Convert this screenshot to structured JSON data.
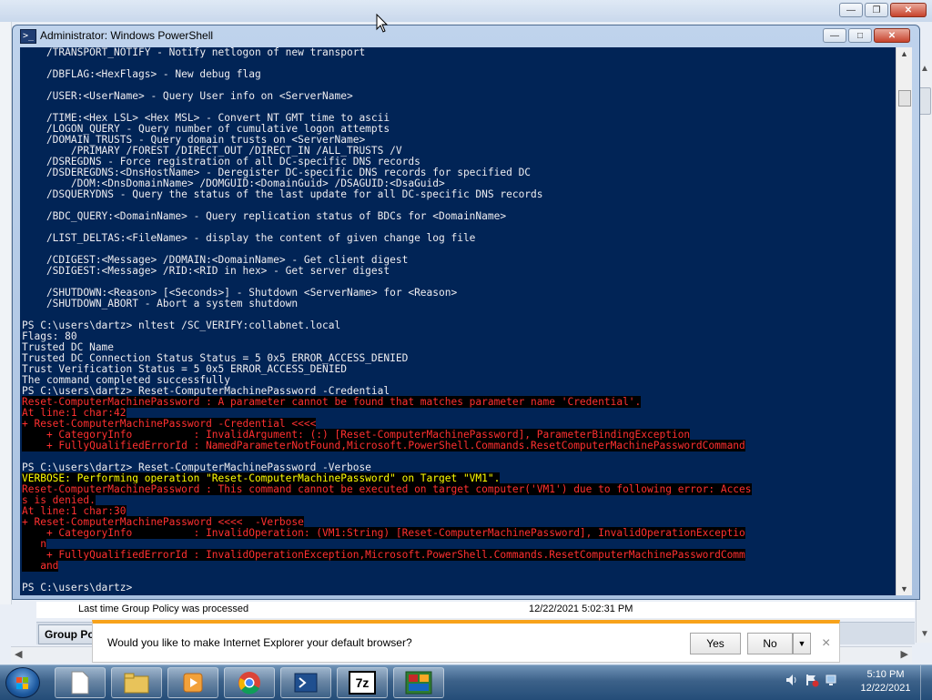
{
  "background": {
    "group_policy": {
      "label": "Last time Group Policy was processed",
      "value": "12/22/2021 5:02:31 PM"
    },
    "tab_label": "Group Poli"
  },
  "powershell": {
    "title": "Administrator: Windows PowerShell",
    "console_lines": [
      {
        "t": "    /TRANSPORT_NOTIFY - Notify netlogon of new transport",
        "s": "out"
      },
      {
        "t": "",
        "s": "out"
      },
      {
        "t": "    /DBFLAG:<HexFlags> - New debug flag",
        "s": "out"
      },
      {
        "t": "",
        "s": "out"
      },
      {
        "t": "    /USER:<UserName> - Query User info on <ServerName>",
        "s": "out"
      },
      {
        "t": "",
        "s": "out"
      },
      {
        "t": "    /TIME:<Hex LSL> <Hex MSL> - Convert NT GMT time to ascii",
        "s": "out"
      },
      {
        "t": "    /LOGON_QUERY - Query number of cumulative logon attempts",
        "s": "out"
      },
      {
        "t": "    /DOMAIN_TRUSTS - Query domain trusts on <ServerName>",
        "s": "out"
      },
      {
        "t": "        /PRIMARY /FOREST /DIRECT_OUT /DIRECT_IN /ALL_TRUSTS /V",
        "s": "out"
      },
      {
        "t": "    /DSREGDNS - Force registration of all DC-specific DNS records",
        "s": "out"
      },
      {
        "t": "    /DSDEREGDNS:<DnsHostName> - Deregister DC-specific DNS records for specified DC",
        "s": "out"
      },
      {
        "t": "        /DOM:<DnsDomainName> /DOMGUID:<DomainGuid> /DSAGUID:<DsaGuid>",
        "s": "out"
      },
      {
        "t": "    /DSQUERYDNS - Query the status of the last update for all DC-specific DNS records",
        "s": "out"
      },
      {
        "t": "",
        "s": "out"
      },
      {
        "t": "    /BDC_QUERY:<DomainName> - Query replication status of BDCs for <DomainName>",
        "s": "out"
      },
      {
        "t": "",
        "s": "out"
      },
      {
        "t": "    /LIST_DELTAS:<FileName> - display the content of given change log file",
        "s": "out"
      },
      {
        "t": "",
        "s": "out"
      },
      {
        "t": "    /CDIGEST:<Message> /DOMAIN:<DomainName> - Get client digest",
        "s": "out"
      },
      {
        "t": "    /SDIGEST:<Message> /RID:<RID in hex> - Get server digest",
        "s": "out"
      },
      {
        "t": "",
        "s": "out"
      },
      {
        "t": "    /SHUTDOWN:<Reason> [<Seconds>] - Shutdown <ServerName> for <Reason>",
        "s": "out"
      },
      {
        "t": "    /SHUTDOWN_ABORT - Abort a system shutdown",
        "s": "out"
      },
      {
        "t": "",
        "s": "out"
      },
      {
        "t": "PS C:\\users\\dartz> nltest /SC_VERIFY:collabnet.local",
        "s": "out"
      },
      {
        "t": "Flags: 80",
        "s": "out"
      },
      {
        "t": "Trusted DC Name",
        "s": "out"
      },
      {
        "t": "Trusted DC Connection Status Status = 5 0x5 ERROR_ACCESS_DENIED",
        "s": "out"
      },
      {
        "t": "Trust Verification Status = 5 0x5 ERROR_ACCESS_DENIED",
        "s": "out"
      },
      {
        "t": "The command completed successfully",
        "s": "out"
      },
      {
        "t": "PS C:\\users\\dartz> Reset-ComputerMachinePassword -Credential",
        "s": "out"
      },
      {
        "t": "Reset-ComputerMachinePassword : A parameter cannot be found that matches parameter name 'Credential'.",
        "s": "err"
      },
      {
        "t": "At line:1 char:42",
        "s": "err"
      },
      {
        "t": "+ Reset-ComputerMachinePassword -Credential <<<<",
        "s": "err"
      },
      {
        "t": "    + CategoryInfo          : InvalidArgument: (:) [Reset-ComputerMachinePassword], ParameterBindingException",
        "s": "err"
      },
      {
        "t": "    + FullyQualifiedErrorId : NamedParameterNotFound,Microsoft.PowerShell.Commands.ResetComputerMachinePasswordCommand",
        "s": "err"
      },
      {
        "t": "",
        "s": "out"
      },
      {
        "t": "PS C:\\users\\dartz> Reset-ComputerMachinePassword -Verbose",
        "s": "out"
      },
      {
        "t": "VERBOSE: Performing operation \"Reset-ComputerMachinePassword\" on Target \"VM1\".",
        "s": "warn"
      },
      {
        "t": "Reset-ComputerMachinePassword : This command cannot be executed on target computer('VM1') due to following error: Acces",
        "s": "err"
      },
      {
        "t": "s is denied.",
        "s": "err"
      },
      {
        "t": "At line:1 char:30",
        "s": "err"
      },
      {
        "t": "+ Reset-ComputerMachinePassword <<<<  -Verbose",
        "s": "err"
      },
      {
        "t": "    + CategoryInfo          : InvalidOperation: (VM1:String) [Reset-ComputerMachinePassword], InvalidOperationExceptio",
        "s": "err"
      },
      {
        "t": "   n",
        "s": "err"
      },
      {
        "t": "    + FullyQualifiedErrorId : InvalidOperationException,Microsoft.PowerShell.Commands.ResetComputerMachinePasswordComm",
        "s": "err"
      },
      {
        "t": "   and",
        "s": "err"
      },
      {
        "t": "",
        "s": "out"
      },
      {
        "t": "PS C:\\users\\dartz> ",
        "s": "out"
      }
    ]
  },
  "ie_prompt": {
    "message": "Would you like to make Internet Explorer your default browser?",
    "yes_label": "Yes",
    "no_label": "No",
    "dropdown_glyph": "▼",
    "close_glyph": "×"
  },
  "taskbar": {
    "apps": [
      "file-icon",
      "folder-icon",
      "media-player-icon",
      "chrome-icon",
      "powershell-icon",
      "7zip-icon",
      "app-icon"
    ],
    "seven_zip_text": "7z",
    "clock_time": "5:10 PM",
    "clock_date": "12/22/2021"
  },
  "colors": {
    "console_bg": "#012456",
    "console_text": "#eeedf0",
    "error_text": "#ff3030",
    "verbose_text": "#ffff00",
    "ie_accent": "#f7a21a"
  }
}
